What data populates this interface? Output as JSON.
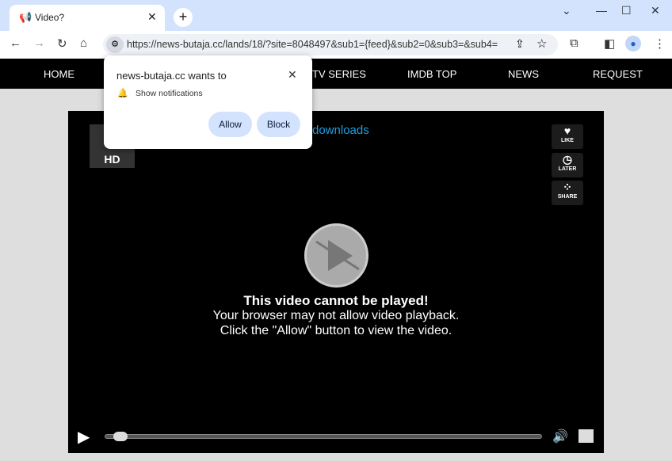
{
  "browser": {
    "tab_title": "Video?",
    "url": "https://news-butaja.cc/lands/18/?site=8048497&sub1={feed}&sub2=0&sub3=&sub4="
  },
  "nav": {
    "items": [
      "HOME",
      "TV SERIES",
      "IMDB TOP",
      "NEWS",
      "REQUEST"
    ]
  },
  "video": {
    "hd_label": "HD",
    "downloads_link": "downloads",
    "like": "LIKE",
    "later": "LATER",
    "share": "SHARE",
    "msg_title": "This video cannot be played!",
    "msg_line1": "Your browser may not allow video playback.",
    "msg_line2": "Click the \"Allow\" button to view the video.",
    "progress": 0.02
  },
  "popup": {
    "title": "news-butaja.cc wants to",
    "permission": "Show notifications",
    "allow": "Allow",
    "block": "Block"
  },
  "colors": {
    "tabbar": "#d3e3fd",
    "link": "#1fa0e0",
    "button": "#d3e3fd"
  }
}
